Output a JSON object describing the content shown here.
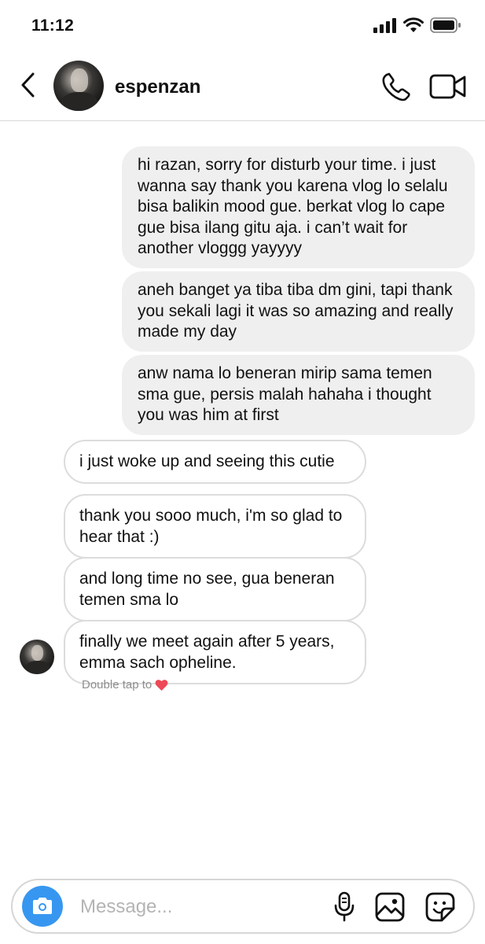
{
  "status_bar": {
    "time": "11:12",
    "icons": [
      "cellular-signal-icon",
      "wifi-icon",
      "battery-icon"
    ]
  },
  "header": {
    "back_icon": "chevron-left-icon",
    "username": "espenzan",
    "call_icon": "phone-icon",
    "video_icon": "video-camera-icon"
  },
  "messages": {
    "sent": [
      "hi razan, sorry for disturb your time. i just wanna say thank you karena vlog lo selalu bisa balikin mood gue. berkat vlog lo cape gue bisa ilang gitu aja. i can’t wait for another vloggg yayyyy",
      "aneh banget ya tiba tiba dm gini, tapi thank you sekali lagi it was so amazing and really made my day",
      "anw nama lo beneran mirip sama temen sma gue, persis malah hahaha i thought you was him at first"
    ],
    "received": [
      "i just woke up and seeing this cutie",
      "thank you sooo much, i'm so glad to hear that :)",
      "and long time no see, gua beneran temen sma lo",
      "finally we meet again after 5 years, emma sach opheline."
    ]
  },
  "reaction_hint": {
    "text": "Double tap to",
    "icon": "heart-icon",
    "color": "#ed4956"
  },
  "composer": {
    "placeholder": "Message...",
    "value": "",
    "camera_icon": "camera-icon",
    "mic_icon": "microphone-icon",
    "gallery_icon": "image-icon",
    "sticker_icon": "sticker-icon",
    "accent_color": "#3797f0"
  }
}
